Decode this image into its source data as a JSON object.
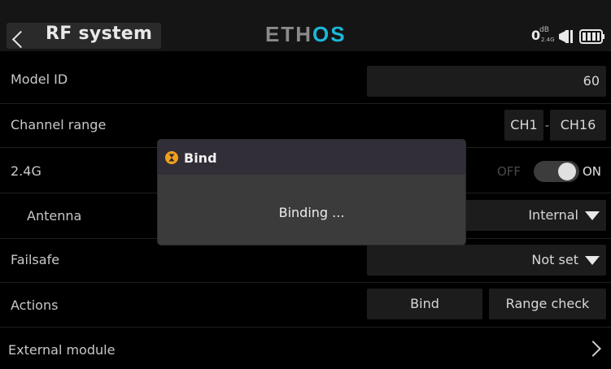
{
  "header": {
    "title": "RF system",
    "brand_prefix": "ETH",
    "brand_suffix": "OS",
    "rssi_value": "0",
    "rssi_unit": "dB",
    "rssi_band": "2.4G",
    "accent_color": "#1cb8d9"
  },
  "rows": {
    "model_id": {
      "label": "Model ID",
      "value": "60"
    },
    "channel_range": {
      "label": "Channel range",
      "from": "CH1",
      "separator": "-",
      "to": "CH16"
    },
    "band_24g": {
      "label": "2.4G",
      "off_label": "OFF",
      "on_label": "ON",
      "state": "on"
    },
    "antenna": {
      "label": "Antenna",
      "value": "Internal"
    },
    "failsafe": {
      "label": "Failsafe",
      "value": "Not set"
    },
    "actions": {
      "label": "Actions",
      "bind_label": "Bind",
      "range_check_label": "Range check"
    },
    "external_module": {
      "label": "External module"
    }
  },
  "dialog": {
    "title": "Bind",
    "message": "Binding ...",
    "icon": "hourglass-icon",
    "icon_color": "#f0a020"
  }
}
